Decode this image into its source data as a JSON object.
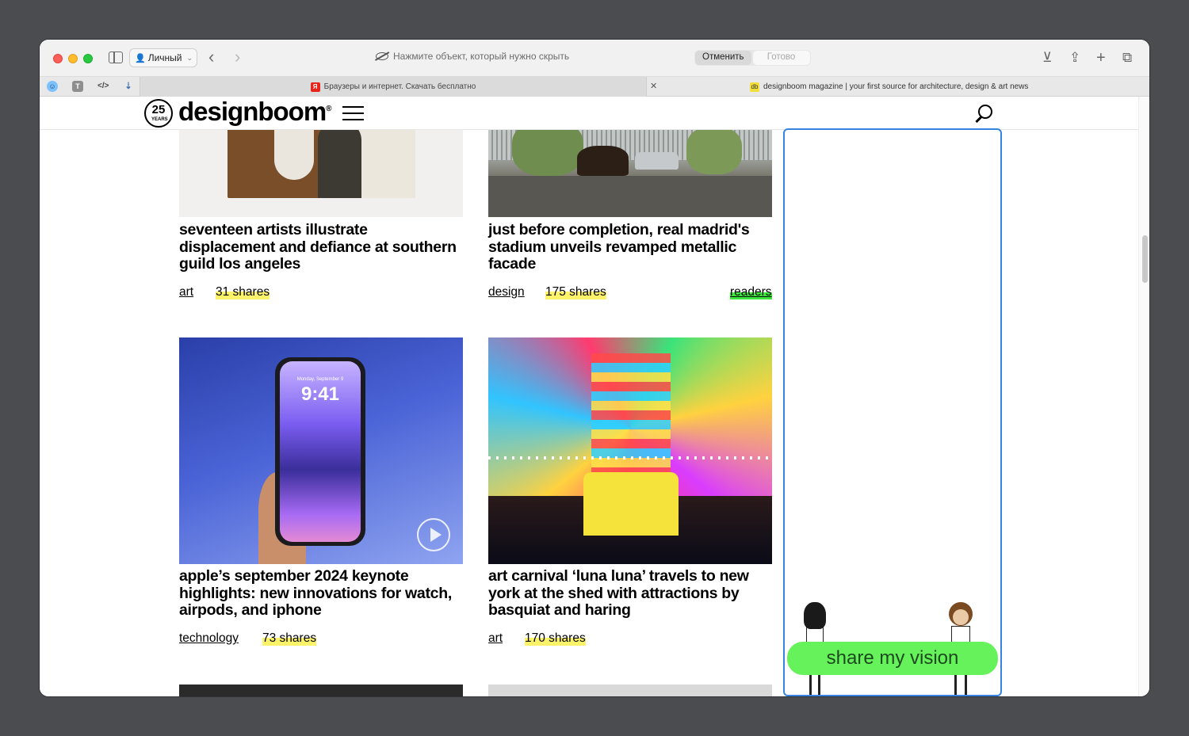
{
  "browser": {
    "profile_label": "Личный",
    "hide_message": "Нажмите объект, который нужно скрыть",
    "cancel_label": "Отменить",
    "done_label": "Готово",
    "tabs": [
      {
        "title": "Браузеры и интернет. Скачать бесплатно",
        "favicon": "Я"
      },
      {
        "title": "designboom magazine | your first source for architecture, design & art news",
        "favicon": "db"
      }
    ],
    "pinned_tabs": [
      "face-icon",
      "T",
      "code-icon",
      "filter-icon"
    ]
  },
  "site": {
    "logo_badge": "25",
    "logo_badge_sub": "YEARS",
    "logo_text": "designboom",
    "logo_reg": "®"
  },
  "articles": [
    {
      "title": "seventeen artists illustrate displacement and defiance at southern guild los angeles",
      "category": "art",
      "shares": "31 shares"
    },
    {
      "title": "just before completion, real madrid's stadium unveils revamped metallic facade",
      "category": "design",
      "shares": "175 shares",
      "badge": "readers"
    },
    {
      "title": "apple’s september 2024 keynote highlights: new innovations for watch, airpods, and iphone",
      "category": "technology",
      "shares": "73 shares",
      "phone_time": "9:41",
      "phone_date": "Monday, September 9"
    },
    {
      "title": "art carnival ‘luna luna’ travels to new york at the shed with attractions by basquiat and haring",
      "category": "art",
      "shares": "170 shares"
    }
  ],
  "ad": {
    "cta": "share my vision",
    "border_color": "#3784e0",
    "pill_color": "#66f25a"
  },
  "colors": {
    "shares_highlight": "#fdf36a",
    "readers_highlight": "#3de93d"
  }
}
